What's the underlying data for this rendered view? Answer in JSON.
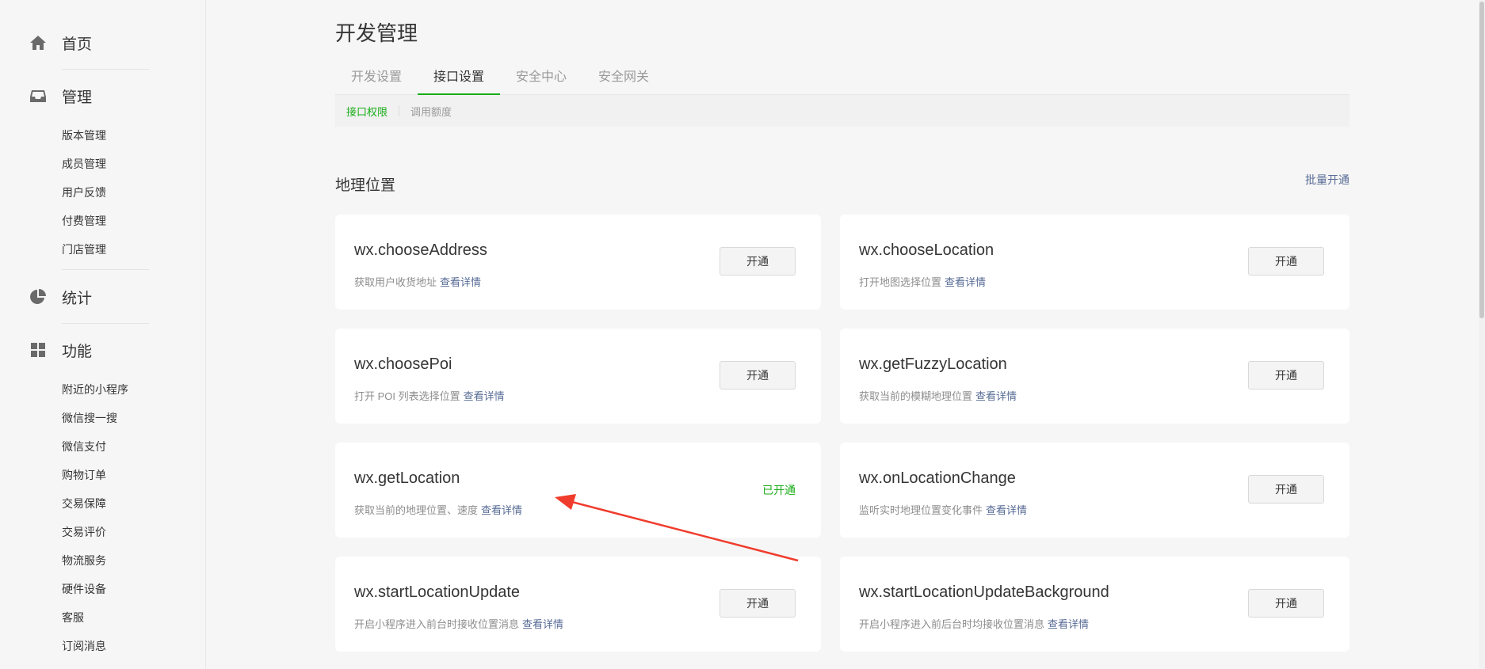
{
  "sidebar": {
    "home": {
      "label": "首页",
      "icon": "home-icon"
    },
    "manage": {
      "label": "管理",
      "icon": "inbox-icon"
    },
    "manage_items": [
      "版本管理",
      "成员管理",
      "用户反馈",
      "付费管理",
      "门店管理"
    ],
    "stats": {
      "label": "统计",
      "icon": "pie-chart-icon"
    },
    "features": {
      "label": "功能",
      "icon": "grid-icon"
    },
    "feature_items": [
      "附近的小程序",
      "微信搜一搜",
      "微信支付",
      "购物订单",
      "交易保障",
      "交易评价",
      "物流服务",
      "硬件设备",
      "客服",
      "订阅消息"
    ]
  },
  "main": {
    "title": "开发管理",
    "tabs": [
      {
        "label": "开发设置",
        "active": false
      },
      {
        "label": "接口设置",
        "active": true
      },
      {
        "label": "安全中心",
        "active": false
      },
      {
        "label": "安全网关",
        "active": false
      }
    ],
    "subtabs": [
      {
        "label": "接口权限",
        "active": true
      },
      {
        "label": "调用额度",
        "active": false
      }
    ],
    "section_title": "地理位置",
    "batch_link": "批量开通",
    "detail_label": "查看详情",
    "enable_label": "开通",
    "enabled_label": "已开通",
    "apis": [
      {
        "name": "wx.chooseAddress",
        "desc": "获取用户收货地址",
        "enabled": false
      },
      {
        "name": "wx.chooseLocation",
        "desc": "打开地图选择位置",
        "enabled": false
      },
      {
        "name": "wx.choosePoi",
        "desc": "打开 POI 列表选择位置",
        "enabled": false
      },
      {
        "name": "wx.getFuzzyLocation",
        "desc": "获取当前的模糊地理位置",
        "enabled": false
      },
      {
        "name": "wx.getLocation",
        "desc": "获取当前的地理位置、速度",
        "enabled": true
      },
      {
        "name": "wx.onLocationChange",
        "desc": "监听实时地理位置变化事件",
        "enabled": false
      },
      {
        "name": "wx.startLocationUpdate",
        "desc": "开启小程序进入前台时接收位置消息",
        "enabled": false
      },
      {
        "name": "wx.startLocationUpdateBackground",
        "desc": "开启小程序进入前后台时均接收位置消息",
        "enabled": false
      }
    ]
  },
  "colors": {
    "accent": "#1aad19",
    "link": "#576b95",
    "annotation_arrow": "#f03c2c"
  }
}
